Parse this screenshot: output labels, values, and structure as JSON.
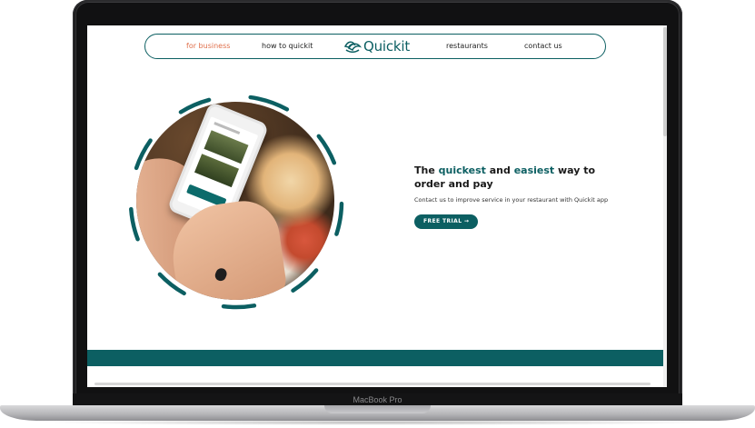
{
  "device": {
    "label": "MacBook Pro"
  },
  "nav": {
    "links": [
      {
        "label": "for business",
        "active": true
      },
      {
        "label": "how to quickit",
        "active": false
      },
      {
        "label": "restaurants",
        "active": false
      },
      {
        "label": "contact us",
        "active": false
      }
    ],
    "logo_text": "Quickit",
    "logo_icon": "hand-leaf-icon"
  },
  "hero": {
    "headline_parts": {
      "p1": "The ",
      "accent1": "quickest",
      "p2": " and ",
      "accent2": "easiest",
      "p3": " way to order and pay"
    },
    "subtext": "Contact us to improve service in your restaurant with Quickit app",
    "cta_label": "FREE TRIAL →",
    "image_alt": "hands holding a phone showing the Quickit app at a restaurant table"
  },
  "colors": {
    "brand_teal": "#0c5f62",
    "nav_active": "#e0704c",
    "text_dark": "#1a1a1a"
  }
}
